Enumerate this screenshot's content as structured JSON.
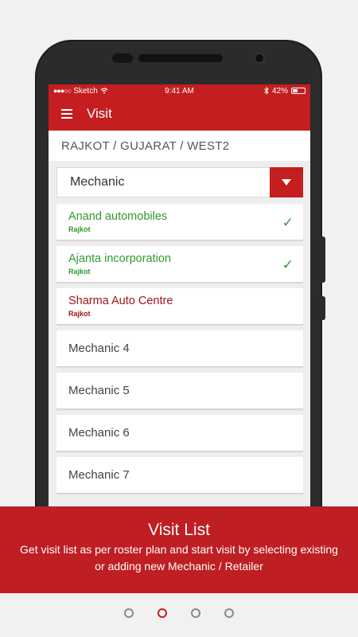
{
  "status_bar": {
    "carrier": "Sketch",
    "time": "9:41 AM",
    "battery": "42%"
  },
  "app_bar": {
    "title": "Visit"
  },
  "breadcrumb": "RAJKOT / GUJARAT / WEST2",
  "filter": {
    "selected": "Mechanic"
  },
  "list": [
    {
      "name": "Anand automobiles",
      "city": "Rajkot",
      "state": "visited"
    },
    {
      "name": "Ajanta incorporation",
      "city": "Rajkot",
      "state": "visited"
    },
    {
      "name": "Sharma Auto Centre",
      "city": "Rajkot",
      "state": "pending"
    },
    {
      "name": "Mechanic 4"
    },
    {
      "name": "Mechanic 5"
    },
    {
      "name": "Mechanic 6"
    },
    {
      "name": "Mechanic 7"
    }
  ],
  "banner": {
    "title": "Visit List",
    "description": "Get visit list as per roster plan and start visit by selecting  existing  or adding new Mechanic / Retailer"
  },
  "pager": {
    "count": 4,
    "active_index": 1
  },
  "colors": {
    "brand_red": "#c41e20",
    "visited_green": "#2f9a2f",
    "pending_red": "#a01316"
  },
  "icons": {
    "menu": "hamburger-icon",
    "dropdown": "triangle-down-icon",
    "visited": "checkmark-icon",
    "wifi": "wifi-icon",
    "bluetooth": "bluetooth-icon",
    "battery": "battery-icon"
  }
}
